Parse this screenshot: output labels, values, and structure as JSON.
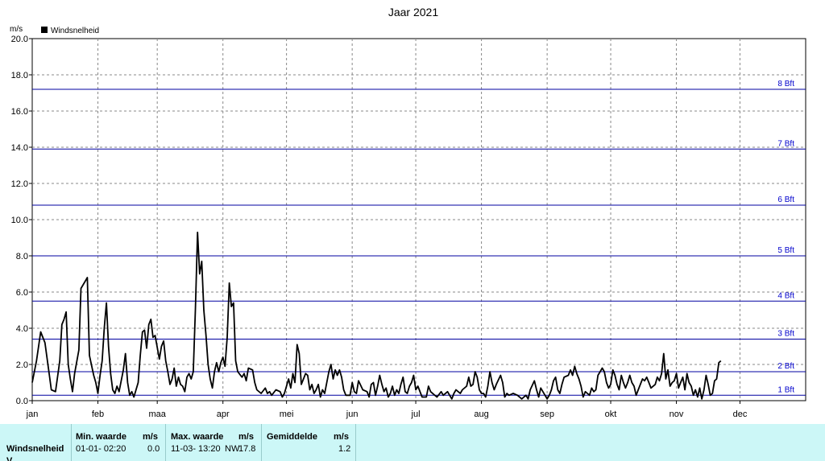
{
  "chart_data": {
    "type": "line",
    "title": "Jaar 2021",
    "ylabel": "m/s",
    "ylim": [
      0,
      20
    ],
    "grid": true,
    "legend_position": "top-left",
    "y_ticks": [
      "0.0",
      "2.0",
      "4.0",
      "6.0",
      "8.0",
      "10.0",
      "12.0",
      "14.0",
      "16.0",
      "18.0",
      "20.0"
    ],
    "months": [
      "jan",
      "feb",
      "maa",
      "apr",
      "mei",
      "jun",
      "jul",
      "aug",
      "sep",
      "okt",
      "nov",
      "dec"
    ],
    "beaufort": [
      {
        "label": "1 Bft",
        "value": 0.3
      },
      {
        "label": "2 Bft",
        "value": 1.6
      },
      {
        "label": "3 Bft",
        "value": 3.4
      },
      {
        "label": "4 Bft",
        "value": 5.5
      },
      {
        "label": "5 Bft",
        "value": 8.0
      },
      {
        "label": "6 Bft",
        "value": 10.8
      },
      {
        "label": "7 Bft",
        "value": 13.9
      },
      {
        "label": "8 Bft",
        "value": 17.2
      }
    ],
    "series": [
      {
        "name": "Windsnelheid",
        "color": "#000000",
        "points": [
          [
            0,
            1.0
          ],
          [
            2,
            2.2
          ],
          [
            4,
            3.8
          ],
          [
            6,
            3.2
          ],
          [
            8,
            1.5
          ],
          [
            9,
            0.6
          ],
          [
            11,
            0.5
          ],
          [
            13,
            2.2
          ],
          [
            14,
            4.2
          ],
          [
            15,
            4.5
          ],
          [
            16,
            4.9
          ],
          [
            17,
            2.0
          ],
          [
            18,
            1.2
          ],
          [
            19,
            0.5
          ],
          [
            20,
            1.5
          ],
          [
            22,
            2.8
          ],
          [
            23,
            6.2
          ],
          [
            25,
            6.6
          ],
          [
            26,
            6.8
          ],
          [
            27,
            2.5
          ],
          [
            29,
            1.4
          ],
          [
            30,
            1.0
          ],
          [
            31,
            0.4
          ],
          [
            32,
            1.4
          ],
          [
            33,
            2.2
          ],
          [
            34,
            4.0
          ],
          [
            35,
            5.4
          ],
          [
            36,
            3.0
          ],
          [
            37,
            1.5
          ],
          [
            38,
            0.6
          ],
          [
            39,
            0.4
          ],
          [
            40,
            0.8
          ],
          [
            41,
            0.5
          ],
          [
            43,
            1.7
          ],
          [
            44,
            2.6
          ],
          [
            45,
            1.0
          ],
          [
            46,
            0.3
          ],
          [
            47,
            0.5
          ],
          [
            48,
            0.2
          ],
          [
            50,
            1.0
          ],
          [
            51,
            2.5
          ],
          [
            52,
            3.8
          ],
          [
            53,
            3.9
          ],
          [
            54,
            2.9
          ],
          [
            55,
            4.2
          ],
          [
            56,
            4.5
          ],
          [
            57,
            3.5
          ],
          [
            58,
            3.6
          ],
          [
            60,
            2.3
          ],
          [
            61,
            3.0
          ],
          [
            62,
            3.3
          ],
          [
            63,
            2.2
          ],
          [
            64,
            1.6
          ],
          [
            65,
            0.9
          ],
          [
            66,
            1.2
          ],
          [
            67,
            1.8
          ],
          [
            68,
            0.8
          ],
          [
            69,
            1.3
          ],
          [
            70,
            0.9
          ],
          [
            71,
            0.8
          ],
          [
            72,
            0.5
          ],
          [
            73,
            1.3
          ],
          [
            74,
            1.5
          ],
          [
            75,
            1.2
          ],
          [
            76,
            1.6
          ],
          [
            77,
            5.0
          ],
          [
            78,
            9.3
          ],
          [
            79,
            7.0
          ],
          [
            80,
            7.7
          ],
          [
            81,
            5.0
          ],
          [
            82,
            3.6
          ],
          [
            83,
            2.0
          ],
          [
            84,
            1.2
          ],
          [
            85,
            0.7
          ],
          [
            86,
            1.6
          ],
          [
            87,
            2.1
          ],
          [
            88,
            1.6
          ],
          [
            89,
            2.1
          ],
          [
            90,
            2.4
          ],
          [
            91,
            1.9
          ],
          [
            92,
            3.5
          ],
          [
            93,
            6.5
          ],
          [
            94,
            5.2
          ],
          [
            95,
            5.4
          ],
          [
            96,
            2.2
          ],
          [
            97,
            1.6
          ],
          [
            99,
            1.3
          ],
          [
            100,
            1.5
          ],
          [
            101,
            1.1
          ],
          [
            102,
            1.8
          ],
          [
            104,
            1.7
          ],
          [
            105,
            1.0
          ],
          [
            106,
            0.6
          ],
          [
            108,
            0.4
          ],
          [
            110,
            0.7
          ],
          [
            111,
            0.4
          ],
          [
            112,
            0.5
          ],
          [
            113,
            0.3
          ],
          [
            115,
            0.6
          ],
          [
            117,
            0.5
          ],
          [
            118,
            0.2
          ],
          [
            119,
            0.4
          ],
          [
            121,
            1.2
          ],
          [
            122,
            0.7
          ],
          [
            123,
            1.5
          ],
          [
            124,
            1.0
          ],
          [
            125,
            3.1
          ],
          [
            126,
            2.6
          ],
          [
            127,
            0.9
          ],
          [
            128,
            1.2
          ],
          [
            129,
            1.5
          ],
          [
            130,
            1.4
          ],
          [
            131,
            0.6
          ],
          [
            132,
            0.9
          ],
          [
            133,
            0.4
          ],
          [
            134,
            0.6
          ],
          [
            135,
            0.9
          ],
          [
            136,
            0.2
          ],
          [
            137,
            0.6
          ],
          [
            138,
            0.4
          ],
          [
            140,
            1.6
          ],
          [
            141,
            2.0
          ],
          [
            142,
            1.2
          ],
          [
            143,
            1.7
          ],
          [
            144,
            1.4
          ],
          [
            145,
            1.7
          ],
          [
            146,
            1.3
          ],
          [
            147,
            0.6
          ],
          [
            148,
            0.3
          ],
          [
            150,
            0.3
          ],
          [
            151,
            1.0
          ],
          [
            152,
            0.5
          ],
          [
            153,
            0.4
          ],
          [
            154,
            1.1
          ],
          [
            156,
            0.6
          ],
          [
            158,
            0.5
          ],
          [
            159,
            0.2
          ],
          [
            160,
            0.9
          ],
          [
            161,
            1.0
          ],
          [
            162,
            0.3
          ],
          [
            163,
            0.8
          ],
          [
            164,
            1.4
          ],
          [
            165,
            0.9
          ],
          [
            166,
            0.5
          ],
          [
            167,
            0.7
          ],
          [
            168,
            0.2
          ],
          [
            169,
            0.4
          ],
          [
            170,
            0.8
          ],
          [
            171,
            0.3
          ],
          [
            172,
            0.6
          ],
          [
            173,
            0.4
          ],
          [
            174,
            0.9
          ],
          [
            175,
            1.3
          ],
          [
            176,
            0.5
          ],
          [
            177,
            0.4
          ],
          [
            178,
            0.8
          ],
          [
            179,
            1.0
          ],
          [
            180,
            1.4
          ],
          [
            181,
            0.6
          ],
          [
            182,
            0.8
          ],
          [
            184,
            0.2
          ],
          [
            186,
            0.2
          ],
          [
            187,
            0.8
          ],
          [
            188,
            0.5
          ],
          [
            190,
            0.3
          ],
          [
            191,
            0.2
          ],
          [
            193,
            0.5
          ],
          [
            194,
            0.3
          ],
          [
            196,
            0.5
          ],
          [
            197,
            0.3
          ],
          [
            198,
            0.1
          ],
          [
            199,
            0.4
          ],
          [
            200,
            0.6
          ],
          [
            201,
            0.5
          ],
          [
            202,
            0.4
          ],
          [
            203,
            0.6
          ],
          [
            205,
            0.8
          ],
          [
            206,
            1.3
          ],
          [
            207,
            0.8
          ],
          [
            208,
            0.9
          ],
          [
            209,
            1.6
          ],
          [
            210,
            1.3
          ],
          [
            211,
            0.6
          ],
          [
            212,
            0.4
          ],
          [
            213,
            0.4
          ],
          [
            214,
            0.2
          ],
          [
            215,
            0.8
          ],
          [
            216,
            1.6
          ],
          [
            217,
            1.0
          ],
          [
            218,
            0.6
          ],
          [
            219,
            0.9
          ],
          [
            221,
            1.4
          ],
          [
            222,
            1.0
          ],
          [
            223,
            0.2
          ],
          [
            224,
            0.4
          ],
          [
            225,
            0.3
          ],
          [
            227,
            0.4
          ],
          [
            229,
            0.3
          ],
          [
            231,
            0.1
          ],
          [
            233,
            0.3
          ],
          [
            234,
            0.1
          ],
          [
            235,
            0.6
          ],
          [
            237,
            1.1
          ],
          [
            238,
            0.6
          ],
          [
            239,
            0.2
          ],
          [
            240,
            0.7
          ],
          [
            242,
            0.3
          ],
          [
            243,
            0.1
          ],
          [
            244,
            0.3
          ],
          [
            245,
            0.6
          ],
          [
            246,
            1.1
          ],
          [
            247,
            1.3
          ],
          [
            248,
            0.6
          ],
          [
            249,
            0.4
          ],
          [
            250,
            0.9
          ],
          [
            251,
            1.3
          ],
          [
            253,
            1.4
          ],
          [
            254,
            1.7
          ],
          [
            255,
            1.4
          ],
          [
            256,
            1.9
          ],
          [
            257,
            1.5
          ],
          [
            258,
            1.2
          ],
          [
            259,
            0.8
          ],
          [
            260,
            0.2
          ],
          [
            261,
            0.5
          ],
          [
            262,
            0.4
          ],
          [
            263,
            0.3
          ],
          [
            264,
            0.7
          ],
          [
            265,
            0.5
          ],
          [
            266,
            0.6
          ],
          [
            267,
            1.4
          ],
          [
            268,
            1.6
          ],
          [
            269,
            1.8
          ],
          [
            270,
            1.6
          ],
          [
            271,
            1.0
          ],
          [
            272,
            0.7
          ],
          [
            273,
            0.9
          ],
          [
            274,
            1.7
          ],
          [
            275,
            1.4
          ],
          [
            276,
            0.9
          ],
          [
            277,
            0.6
          ],
          [
            278,
            1.4
          ],
          [
            279,
            1.0
          ],
          [
            280,
            0.7
          ],
          [
            281,
            1.0
          ],
          [
            282,
            1.4
          ],
          [
            283,
            1.0
          ],
          [
            284,
            0.8
          ],
          [
            285,
            0.3
          ],
          [
            286,
            0.6
          ],
          [
            287,
            0.9
          ],
          [
            288,
            1.2
          ],
          [
            289,
            1.1
          ],
          [
            290,
            1.3
          ],
          [
            291,
            1.0
          ],
          [
            292,
            0.7
          ],
          [
            294,
            0.9
          ],
          [
            295,
            1.3
          ],
          [
            296,
            1.1
          ],
          [
            297,
            1.5
          ],
          [
            298,
            2.6
          ],
          [
            299,
            1.2
          ],
          [
            300,
            1.7
          ],
          [
            301,
            0.8
          ],
          [
            302,
            1.0
          ],
          [
            303,
            1.1
          ],
          [
            304,
            1.5
          ],
          [
            305,
            0.7
          ],
          [
            306,
            1.0
          ],
          [
            307,
            1.3
          ],
          [
            308,
            0.6
          ],
          [
            309,
            1.5
          ],
          [
            310,
            1.0
          ],
          [
            311,
            0.8
          ],
          [
            312,
            0.3
          ],
          [
            313,
            0.6
          ],
          [
            314,
            0.2
          ],
          [
            315,
            0.7
          ],
          [
            316,
            0.1
          ],
          [
            317,
            0.6
          ],
          [
            318,
            1.4
          ],
          [
            319,
            0.9
          ],
          [
            320,
            0.3
          ],
          [
            321,
            0.4
          ],
          [
            322,
            1.1
          ],
          [
            323,
            1.2
          ],
          [
            324,
            2.1
          ],
          [
            325,
            2.2
          ]
        ]
      }
    ]
  },
  "colors": {
    "beaufort_line": "#0000a0",
    "beaufort_label": "#0000cc",
    "grid": "#888888",
    "footer_bg": "#ccf7f7"
  },
  "stats_table": {
    "headers": {
      "min": "Min. waarde",
      "min_unit": "m/s",
      "max": "Max. waarde",
      "max_unit": "m/s",
      "avg": "Gemiddelde",
      "avg_unit": "m/s"
    },
    "rows": [
      {
        "name": "Windsnelheid",
        "min_date": "01-01- 02:20",
        "min_value": "0.0",
        "max_date": "11-03- 13:20",
        "max_dir": "NW",
        "max_value": "17.8",
        "avg_value": "1.2"
      }
    ],
    "partial_row_label": "V"
  }
}
